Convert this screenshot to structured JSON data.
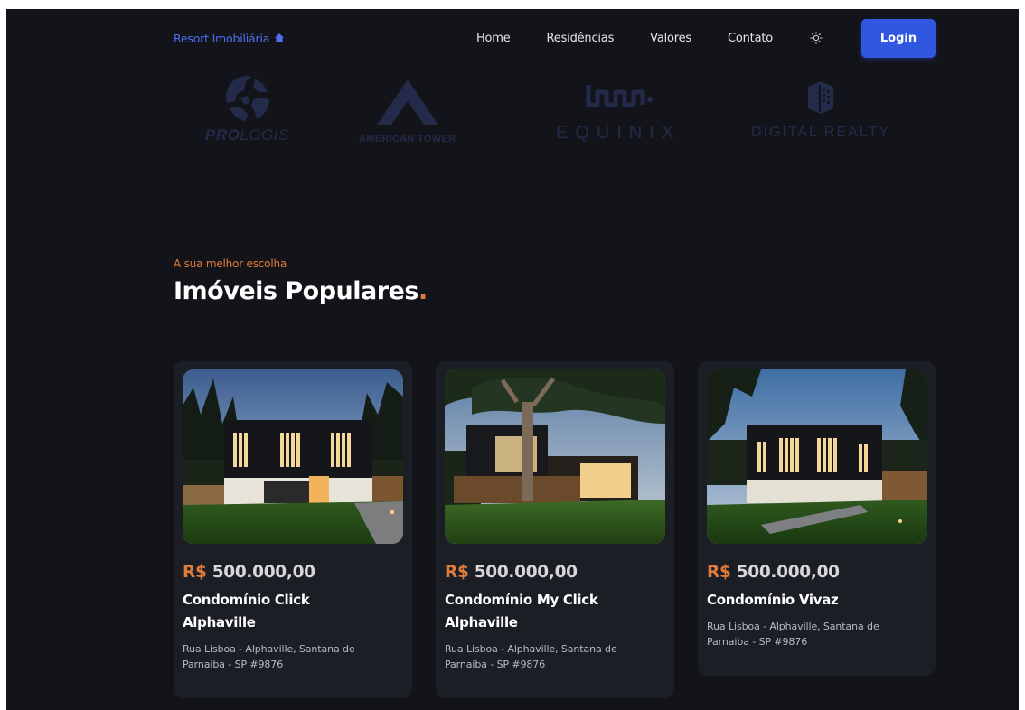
{
  "header": {
    "brand": "Resort Imobiliária",
    "nav": [
      "Home",
      "Residências",
      "Valores",
      "Contato"
    ],
    "login_label": "Login"
  },
  "logos": {
    "prologis_a": "PRO",
    "prologis_b": "LOGIS",
    "american_tower": "AMERICAN TOWER",
    "equinix": "EQUINIX",
    "digital_realty": "DIGITAL REALTY"
  },
  "section": {
    "eyebrow": "A sua melhor escolha",
    "title": "Imóveis Populares",
    "title_dot": "."
  },
  "cards": [
    {
      "currency": "R$",
      "price": "500.000,00",
      "title": "Condomínio Click Alphaville",
      "address": "Rua Lisboa - Alphaville, Santana de Parnaiba - SP #9876"
    },
    {
      "currency": "R$",
      "price": "500.000,00",
      "title": "Condomínio My Click Alphaville",
      "address": "Rua Lisboa - Alphaville, Santana de Parnaiba - SP #9876"
    },
    {
      "currency": "R$",
      "price": "500.000,00",
      "title": "Condomínio Vivaz",
      "address": "Rua Lisboa - Alphaville, Santana de Parnaiba - SP #9876"
    }
  ],
  "colors": {
    "background": "#131419",
    "card": "#1c1e26",
    "accent_orange": "#e07b3a",
    "accent_blue": "#3157e0",
    "logo_muted": "#232a4a"
  },
  "icons": {
    "brand": "home-icon",
    "theme": "sun-icon"
  }
}
